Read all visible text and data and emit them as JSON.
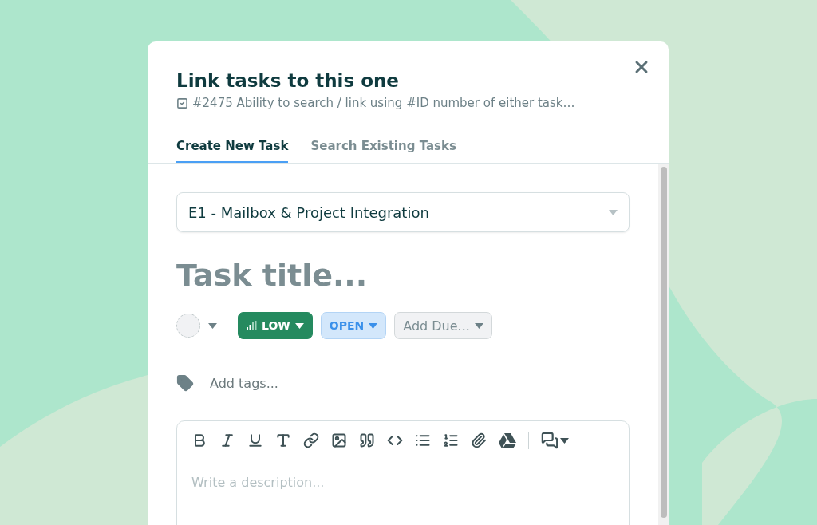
{
  "dialog": {
    "title": "Link tasks to this one",
    "subtitle": "#2475 Ability to search / link using #ID number of either task…"
  },
  "tabs": [
    {
      "label": "Create New Task",
      "selected": true
    },
    {
      "label": "Search Existing Tasks",
      "selected": false
    }
  ],
  "project_select": {
    "value": "E1 - Mailbox & Project Integration"
  },
  "task_title": {
    "placeholder": "Task title..."
  },
  "pills": [
    {
      "kind": "priority",
      "label": "LOW"
    },
    {
      "kind": "status",
      "label": "OPEN"
    },
    {
      "kind": "due",
      "label": "Add Due..."
    }
  ],
  "tags": {
    "placeholder": "Add tags..."
  },
  "description": {
    "placeholder": "Write a description..."
  }
}
